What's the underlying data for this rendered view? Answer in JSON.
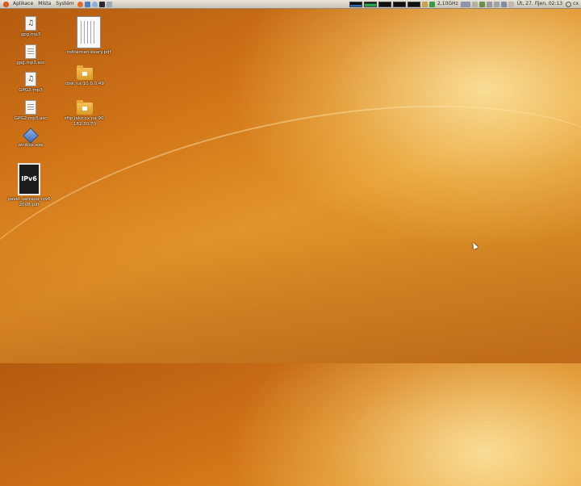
{
  "panel": {
    "menus": [
      "Aplikace",
      "Místa",
      "Systém"
    ],
    "cpu_freq": "2,10GHz",
    "clock": "Út, 27. říjen, 02:13",
    "user": "cx",
    "icons": {
      "logo": "ubuntu-logo-icon",
      "launchers": [
        "firefox-icon",
        "mail-icon",
        "help-icon",
        "terminal-icon",
        "screenshot-icon"
      ],
      "monitors": [
        "cpu-monitor-icon",
        "memory-monitor-icon",
        "network-monitor-icon",
        "swap-monitor-icon",
        "load-monitor-icon"
      ],
      "tray": [
        "lock-icon",
        "battery-icon",
        "keyboard-layout-icon",
        "bluetooth-icon",
        "network-icon",
        "volume-icon",
        "clipboard-icon",
        "display-icon",
        "mail-indicator-icon",
        "power-icon"
      ]
    }
  },
  "desktop_icons": [
    {
      "label": "gpg.mp3",
      "type": "audio"
    },
    {
      "label": "gpg.mp3.asc",
      "type": "text"
    },
    {
      "label": "GPG2.mp3",
      "type": "audio"
    },
    {
      "label": "GPG2.mp3.asc",
      "type": "text"
    },
    {
      "label": "winbox.exe",
      "type": "executable"
    },
    {
      "label": "pavel_satrapa_ipv6 2008.pdf",
      "type": "pdf",
      "thumb_text": "IPv6"
    },
    {
      "label": "rodokmen-keary.pdf",
      "type": "pdf"
    },
    {
      "label": "disk na 10.0.0.49",
      "type": "folder"
    },
    {
      "label": "sftp jako cx na 90. 182.30.70",
      "type": "folder"
    }
  ],
  "colors": {
    "wallpaper": "#d07418",
    "panel": "#dcd6cb"
  }
}
